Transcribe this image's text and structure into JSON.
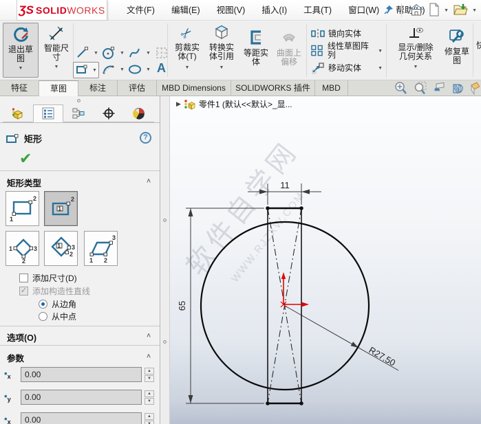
{
  "menubar": {
    "logo_prefix": "ƷS",
    "logo_bold": "SOLID",
    "logo_light": "WORKS",
    "items": [
      "文件(F)",
      "编辑(E)",
      "视图(V)",
      "插入(I)",
      "工具(T)",
      "窗口(W)",
      "帮助(H)"
    ]
  },
  "ribbon": {
    "exit_sketch_l1": "退出草",
    "exit_sketch_l2": "图",
    "smart_dim_l1": "智能尺",
    "smart_dim_l2": "寸",
    "text_tool": "A",
    "trim_l1": "剪裁实",
    "trim_l2": "体(T)",
    "convert_l1": "转换实",
    "convert_l2": "体引用",
    "offset_l1": "等距实",
    "offset_l2": "体",
    "surf_offset_l1": "曲面上",
    "surf_offset_l2": "偏移",
    "mirror": "镜向实体",
    "linear_pattern": "线性草图阵列",
    "move": "移动实体",
    "relations_l1": "显示/删除",
    "relations_l2": "几何关系",
    "repair_l1": "修复草",
    "repair_l2": "图",
    "quick_partial": "快"
  },
  "tabs": [
    "特征",
    "草图",
    "标注",
    "评估",
    "MBD Dimensions",
    "SOLIDWORKS 插件",
    "MBD"
  ],
  "panel": {
    "title": "矩形",
    "rect_type_header": "矩形类型",
    "add_dimensions": "添加尺寸(D)",
    "add_construction": "添加构造性直线",
    "from_corner": "从边角",
    "from_midpoint": "从中点",
    "options_header": "选项(O)",
    "params_header": "参数",
    "params": [
      {
        "axis": "x",
        "value": "0.00"
      },
      {
        "axis": "y",
        "value": "0.00"
      },
      {
        "axis": "x",
        "value": "0.00"
      }
    ]
  },
  "canvas": {
    "feature_tree_label": "零件1 (默认<<默认>_显...",
    "watermark_primary": "软件自学网",
    "watermark_secondary": "WWW.RJZXW.COM",
    "dim_width": "11",
    "dim_height": "65",
    "dim_radius": "R27.50"
  },
  "colors": {
    "logo_red": "#d6001c",
    "sketch_teal": "#2a7199",
    "origin_red": "#e60000",
    "selection_gray": "#c9c9c9",
    "canvas_bottom": "#b9c1d1"
  }
}
